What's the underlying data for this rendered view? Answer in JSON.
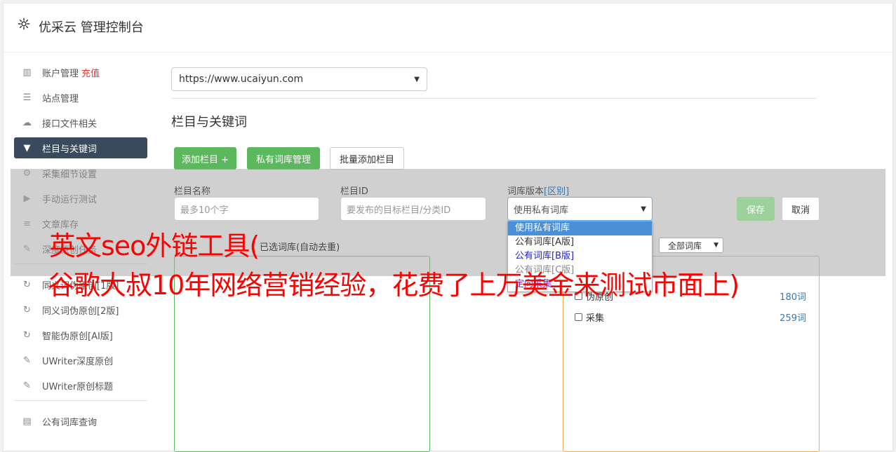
{
  "header": {
    "title": "优采云 管理控制台"
  },
  "sidebar": {
    "items": [
      {
        "label": "账户管理",
        "extra": "充值",
        "icon": "bar-chart-icon",
        "glyph": "▥"
      },
      {
        "label": "站点管理",
        "icon": "server-icon",
        "glyph": "☰"
      },
      {
        "label": "接口文件相关",
        "icon": "cloud-upload-icon",
        "glyph": "☁"
      },
      {
        "label": "栏目与关键词",
        "icon": "filter-icon",
        "glyph": "▼",
        "active": true
      },
      {
        "label": "采集细节设置",
        "icon": "cogs-icon",
        "glyph": "⚙"
      },
      {
        "label": "手动运行测试",
        "icon": "play-icon",
        "glyph": "▶"
      },
      {
        "label": "文章库存",
        "icon": "database-icon",
        "glyph": "≡"
      },
      {
        "label": "深度原创任务",
        "icon": "edit-icon",
        "glyph": "✎"
      }
    ],
    "items2": [
      {
        "label": "同义词伪原创[1版]",
        "icon": "refresh-icon",
        "glyph": "↻"
      },
      {
        "label": "同义词伪原创[2版]",
        "icon": "refresh-icon",
        "glyph": "↻"
      },
      {
        "label": "智能伪原创[AI版]",
        "icon": "refresh-icon",
        "glyph": "↻"
      },
      {
        "label": "UWriter深度原创",
        "icon": "edit-icon",
        "glyph": "✎"
      },
      {
        "label": "UWriter原创标题",
        "icon": "edit-icon",
        "glyph": "✎"
      }
    ],
    "items3": [
      {
        "label": "公有词库查询",
        "icon": "book-icon",
        "glyph": "▤"
      }
    ]
  },
  "main": {
    "site_select": "https://www.ucaiyun.com",
    "section_title": "栏目与关键词",
    "buttons": {
      "add_column": "添加栏目 +",
      "private_lib": "私有词库管理",
      "batch_add": "批量添加栏目"
    },
    "form": {
      "name_label": "栏目名称",
      "name_placeholder": "最多10个字",
      "id_label": "栏目ID",
      "id_placeholder": "要发布的目标栏目/分类ID",
      "lib_label": "词库版本",
      "lib_link": "[区别]",
      "lib_value": "使用私有词库",
      "save": "保存",
      "cancel": "取消"
    },
    "dropdown_options": [
      "使用私有词库",
      "公有词库[A版]",
      "公有词库[B版]",
      "公有词库[C版]",
      "定向采集"
    ],
    "left_panel_label": "已选词库(自动去重)",
    "filter_select": "全部词库",
    "right_rows": [
      {
        "label": "伪原创",
        "count": "180词"
      },
      {
        "label": "采集",
        "count": "259词"
      }
    ]
  },
  "ad_overlay": {
    "line1": "英文seo外链工具(",
    "line2": "谷歌大叔10年网络营销经验，花费了上万美金来测试市面上)"
  }
}
